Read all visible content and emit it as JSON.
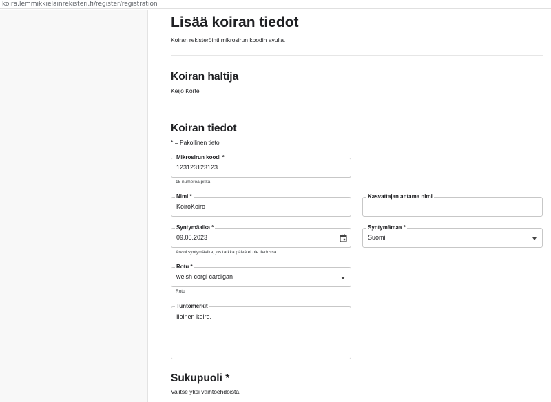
{
  "browser": {
    "url": "koira.lemmikkielainrekisteri.fi/register/registration"
  },
  "page": {
    "title": "Lisää koiran tiedot",
    "subtitle": "Koiran rekisteröinti mikrosirun koodin avulla."
  },
  "owner": {
    "heading": "Koiran haltija",
    "name": "Keijo Korte"
  },
  "dog": {
    "heading": "Koiran tiedot",
    "required_note": "* = Pakollinen tieto",
    "microchip": {
      "label": "Mikrosirun koodi *",
      "value": "123123123123",
      "helper": "15 numeroa pitkä"
    },
    "name": {
      "label": "Nimi *",
      "value": "KoiroKoiro"
    },
    "breeder_name": {
      "label": "Kasvattajan antama nimi",
      "value": ""
    },
    "birth_date": {
      "label": "Syntymäaika *",
      "value": "09.05.2023",
      "helper": "Arvioi syntymäaika, jos tarkka päivä ei ole tiedossa"
    },
    "birth_country": {
      "label": "Syntymämaa *",
      "value": "Suomi"
    },
    "breed": {
      "label": "Rotu *",
      "value": "welsh corgi cardigan",
      "helper": "Rotu"
    },
    "markings": {
      "label": "Tuntomerkit",
      "value": "Iloinen koiro."
    }
  },
  "sex": {
    "heading": "Sukupuoli *",
    "hint": "Valitse yksi vaihtoehdoista."
  },
  "icons": {
    "calendar": "calendar-icon",
    "dropdown": "chevron-down-icon"
  }
}
